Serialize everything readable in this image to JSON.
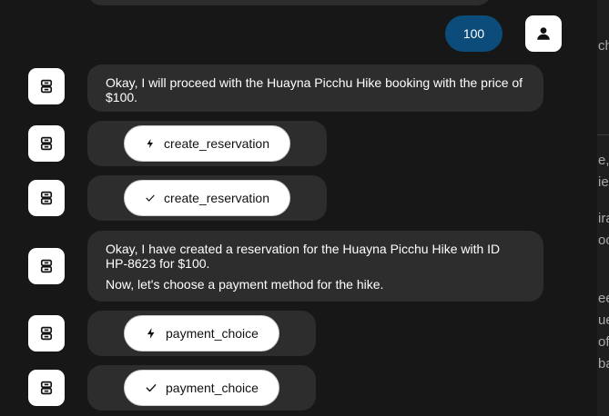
{
  "user_message": {
    "text": "100"
  },
  "messages": [
    {
      "type": "text",
      "paragraphs": [
        "Okay, I will proceed with the Huayna Picchu Hike booking with the price of $100."
      ]
    },
    {
      "type": "tool",
      "icon": "lightning-icon",
      "name": "create_reservation"
    },
    {
      "type": "tool",
      "icon": "check-icon",
      "name": "create_reservation"
    },
    {
      "type": "text",
      "paragraphs": [
        "Okay, I have created a reservation for the Huayna Picchu Hike with ID HP-8623 for $100.",
        "Now, let's choose a payment method for the hike."
      ]
    },
    {
      "type": "tool",
      "icon": "lightning-icon",
      "name": "payment_choice"
    },
    {
      "type": "tool",
      "icon": "check-icon",
      "name": "payment_choice"
    }
  ],
  "side_panel": {
    "fragments": [
      "ch",
      "e,",
      "ie",
      "ira",
      "oo",
      "ee",
      "ue",
      "of",
      "ba"
    ]
  }
}
